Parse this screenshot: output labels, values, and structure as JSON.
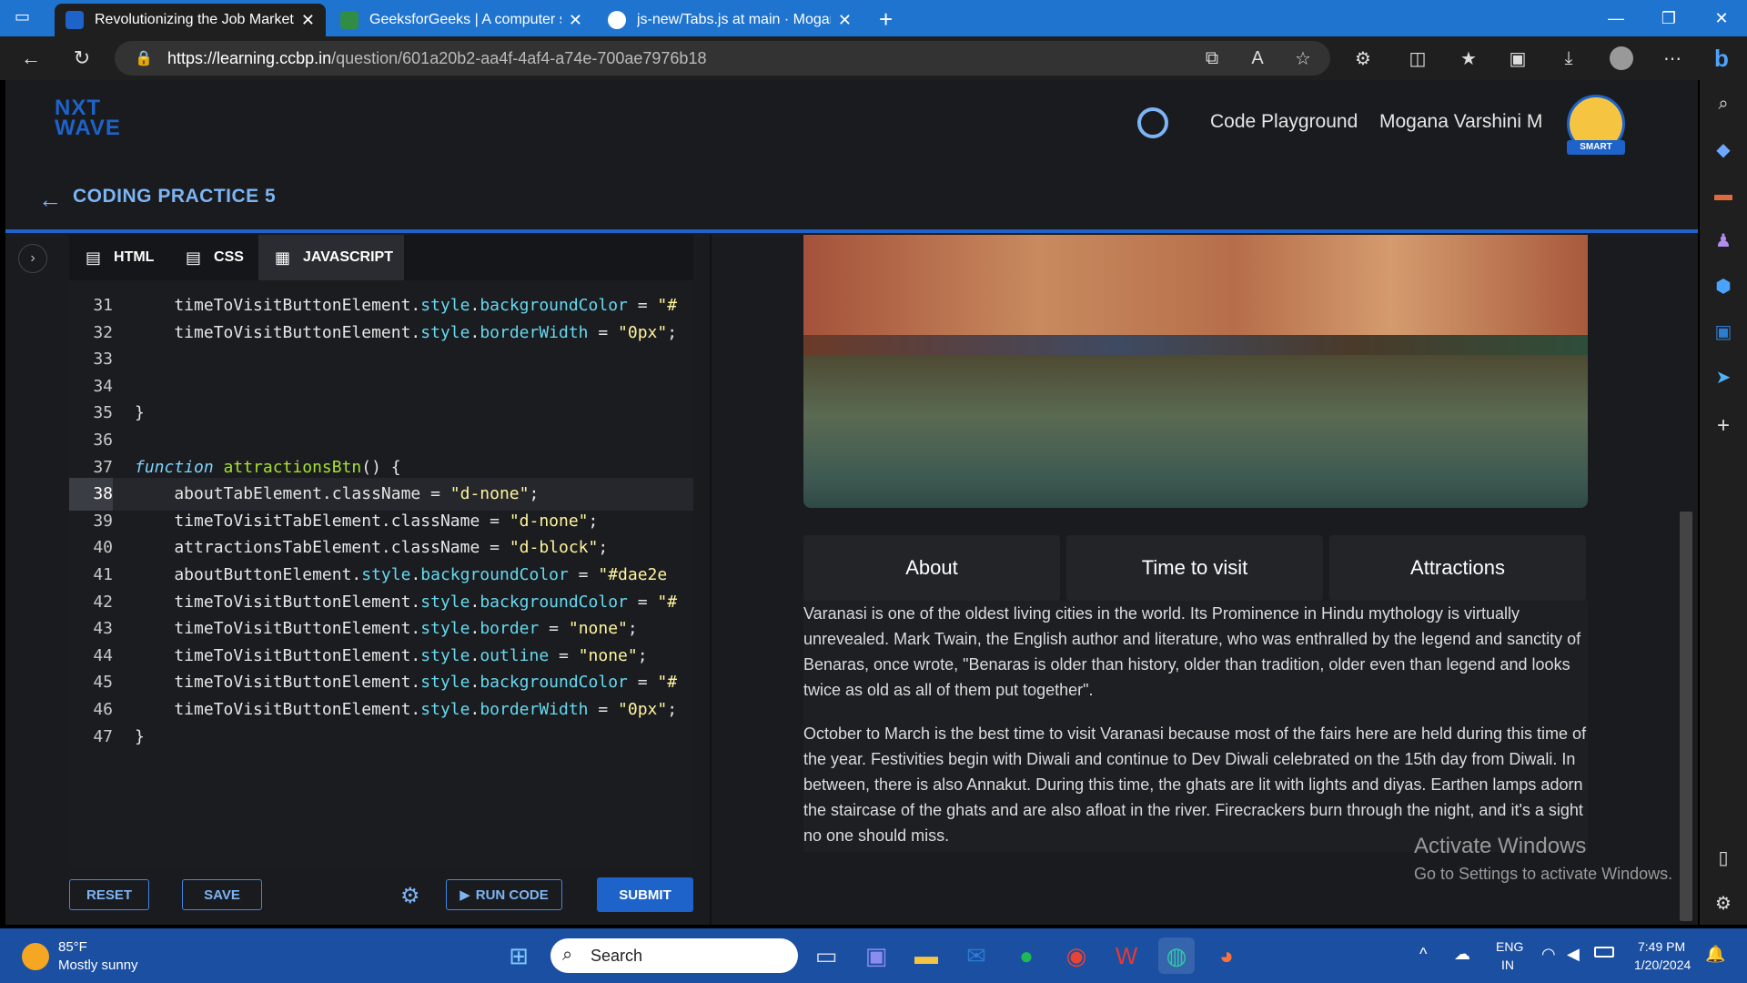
{
  "browser": {
    "tabs": [
      {
        "title": "Revolutionizing the Job Market |",
        "active": true
      },
      {
        "title": "GeeksforGeeks | A computer scie",
        "active": false
      },
      {
        "title": "js-new/Tabs.js at main · MoganaV",
        "active": false
      }
    ],
    "url_host": "https://learning.ccbp.in",
    "url_path": "/question/601a20b2-aa4f-4af4-a74e-700ae7976b18"
  },
  "header": {
    "logo_line1": "NXT",
    "logo_line2": "WAVE",
    "playground": "Code Playground",
    "username": "Mogana Varshini M",
    "badge": "SMART",
    "practice_title": "CODING PRACTICE 5"
  },
  "editor": {
    "tabs": [
      "HTML",
      "CSS",
      "JAVASCRIPT"
    ],
    "active_tab": "JAVASCRIPT",
    "lines": [
      {
        "n": "31",
        "code": "    timeToVisitButtonElement.style.backgroundColor = \"#"
      },
      {
        "n": "32",
        "code": "    timeToVisitButtonElement.style.borderWidth = \"0px\";"
      },
      {
        "n": "33",
        "code": ""
      },
      {
        "n": "34",
        "code": ""
      },
      {
        "n": "35",
        "code": "}"
      },
      {
        "n": "36",
        "code": ""
      },
      {
        "n": "37",
        "code": "function attractionsBtn() {"
      },
      {
        "n": "38",
        "code": "    aboutTabElement.className = \"d-none\";"
      },
      {
        "n": "39",
        "code": "    timeToVisitTabElement.className = \"d-none\";"
      },
      {
        "n": "40",
        "code": "    attractionsTabElement.className = \"d-block\";"
      },
      {
        "n": "41",
        "code": "    aboutButtonElement.style.backgroundColor = \"#dae2e"
      },
      {
        "n": "42",
        "code": "    timeToVisitButtonElement.style.backgroundColor = \"#"
      },
      {
        "n": "43",
        "code": "    timeToVisitButtonElement.style.border = \"none\";"
      },
      {
        "n": "44",
        "code": "    timeToVisitButtonElement.style.outline = \"none\";"
      },
      {
        "n": "45",
        "code": "    timeToVisitButtonElement.style.backgroundColor = \"#"
      },
      {
        "n": "46",
        "code": "    timeToVisitButtonElement.style.borderWidth = \"0px\";"
      },
      {
        "n": "47",
        "code": "}"
      }
    ],
    "buttons": {
      "reset": "RESET",
      "save": "SAVE",
      "run": "RUN CODE",
      "submit": "SUBMIT"
    }
  },
  "preview": {
    "tabs": [
      "About",
      "Time to visit",
      "Attractions"
    ],
    "para1": "Varanasi is one of the oldest living cities in the world. Its Prominence in Hindu mythology is virtually unrevealed. Mark Twain, the English author and literature, who was enthralled by the legend and sanctity of Benaras, once wrote, \"Benaras is older than history, older than tradition, older even than legend and looks twice as old as all of them put together\".",
    "para2": "October to March is the best time to visit Varanasi because most of the fairs here are held during this time of the year. Festivities begin with Diwali and continue to Dev Diwali celebrated on the 15th day from Diwali. In between, there is also Annakut. During this time, the ghats are lit with lights and diyas. Earthen lamps adorn the staircase of the ghats and are also afloat in the river. Firecrackers burn through the night, and it's a sight no one should miss."
  },
  "watermark": {
    "line1": "Activate Windows",
    "line2": "Go to Settings to activate Windows."
  },
  "taskbar": {
    "weather_temp": "85°F",
    "weather_desc": "Mostly sunny",
    "search": "Search",
    "lang1": "ENG",
    "lang2": "IN",
    "time": "7:49 PM",
    "date": "1/20/2024"
  },
  "colors": {
    "accent": "#1e63c9",
    "link": "#7db4f4",
    "titlebar": "#1f74d0"
  }
}
